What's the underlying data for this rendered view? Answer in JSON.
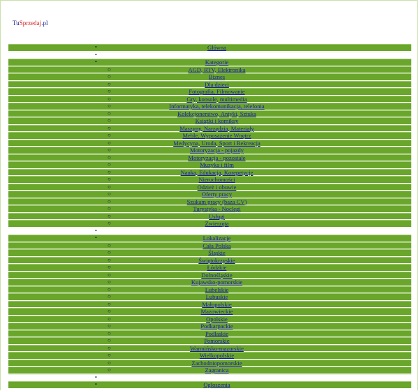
{
  "logo": {
    "part1": "Tu",
    "part2": "Sprzedaj",
    "part3": ".pl"
  },
  "nav": {
    "glowna": " Główna ",
    "kategorie": {
      "label": " Kategorie ",
      "items": [
        "AGD, RTV, Elektronika",
        "Biznes",
        "Dla dzieci",
        "Fotografia, Filmowanie",
        "Gry, konsole, multimedia",
        "Informatyka, telekomunikacja, telefonia",
        "Kolekcjonerstwo, Antyki, Sztuka",
        "Książki i komiksy",
        "Maszyny, Narzędzia, Materiały",
        "Meble, Wyposażenie Wnętrz",
        "Medycyna, Uroda, Sport i Rekreacja",
        "Motoryzacja - pojazdy",
        "Motoryzacja - pozostałe",
        "Muzyka i film",
        "Nauka, Edukacja, Korepetycje",
        "Nieruchomości",
        "Odzież i obuwie",
        "Oferty pracy",
        "Szukam pracy (baza CV)",
        "Turystyka - Noclegi",
        "Usługi",
        "Zwierzęta"
      ]
    },
    "lokalizacje": {
      "label": " Lokalizacje ",
      "items": [
        "Cała Polska",
        "Śląskie",
        "Świętokrzyskie",
        "Łódzkie",
        "Dolnośląskie",
        "Kujawsko-pomorskie",
        "Lubelskie",
        "Lubuskie",
        "Małopolskie",
        "Mazowieckie",
        "Opolskie",
        "Podkarpackie",
        "Podlaskie",
        "Pomorskie",
        "Warmińsko-mazurskie",
        "Wielkopolskie",
        "Zachodniopomorskie",
        "Zagranica"
      ]
    },
    "ogloszenia": " Ogłoszenia "
  }
}
